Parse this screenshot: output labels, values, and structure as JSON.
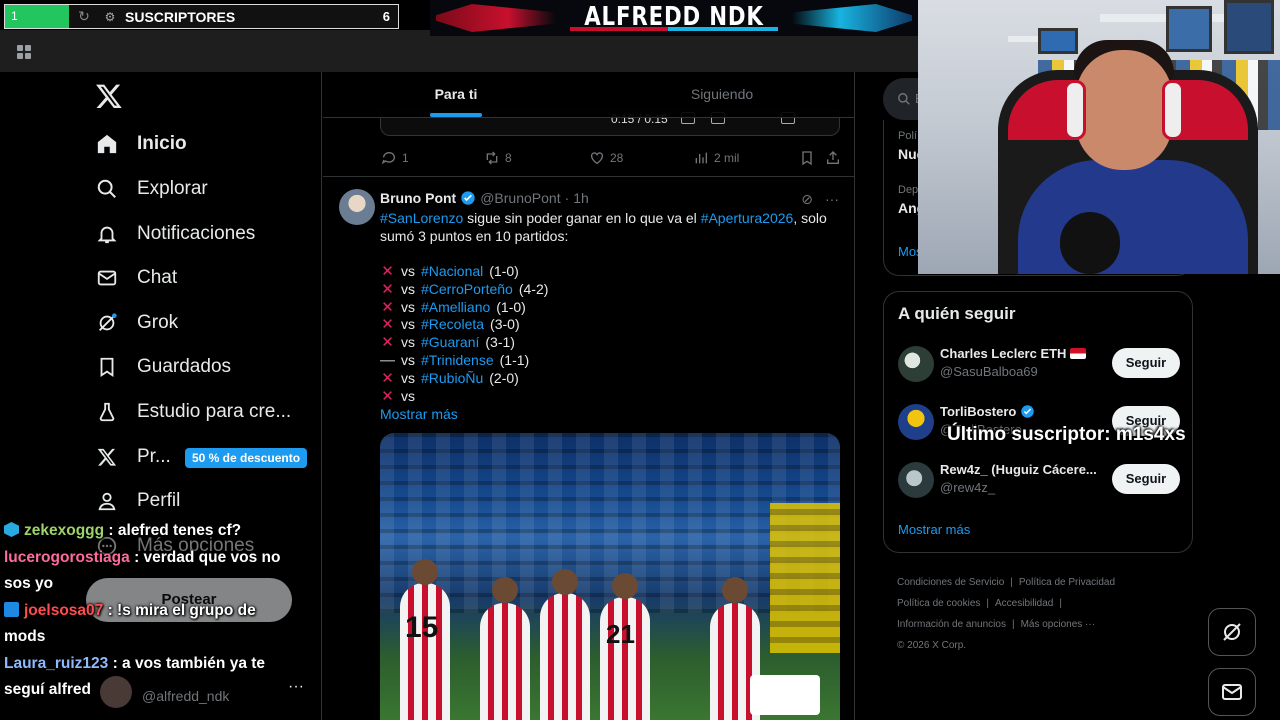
{
  "overlay": {
    "subs_progress_value": "1",
    "subs_label": "SUSCRIPTORES",
    "subs_count": "6",
    "banner_title": "ALFREDD NDK",
    "last_sub_text": "Último suscriptor: m1s4xs"
  },
  "nav": {
    "items": [
      {
        "label": "Inicio",
        "icon": "home-icon"
      },
      {
        "label": "Explorar",
        "icon": "search-icon"
      },
      {
        "label": "Notificaciones",
        "icon": "bell-icon"
      },
      {
        "label": "Chat",
        "icon": "mail-icon"
      },
      {
        "label": "Grok",
        "icon": "grok-icon"
      },
      {
        "label": "Guardados",
        "icon": "bookmark-icon"
      },
      {
        "label": "Estudio para cre...",
        "icon": "flask-icon"
      },
      {
        "label": "Pr...",
        "icon": "x-icon"
      },
      {
        "label": "Perfil",
        "icon": "person-icon"
      },
      {
        "label": "Más opciones",
        "icon": "more-circle-icon"
      }
    ],
    "promo_badge": "50 % de descuento",
    "post_button": "Postear",
    "account_handle": "@alfredd_ndk",
    "account_more": "···"
  },
  "timeline": {
    "tabs": [
      "Para ti",
      "Siguiendo"
    ],
    "video_time": "0:15 / 0:15",
    "prev_actions": {
      "replies": "1",
      "reposts": "8",
      "likes": "28",
      "views": "2 mil"
    },
    "tweet": {
      "name": "Bruno Pont",
      "handle": "@BrunoPont",
      "dot": "·",
      "ago": "1h",
      "text_part1": "#SanLorenzo",
      "text_part2": " sigue sin poder ganar en lo que va el ",
      "text_part3": "#Apertura2026",
      "text_part4": ", solo sumó 3 puntos en 10 partidos:",
      "results": [
        {
          "mark": "✕",
          "pre": "vs",
          "team": "#Nacional",
          "score": "(1-0)"
        },
        {
          "mark": "✕",
          "pre": "vs",
          "team": "#CerroPorteño",
          "score": "(4-2)"
        },
        {
          "mark": "✕",
          "pre": "vs",
          "team": "#Amelliano",
          "score": "(1-0)"
        },
        {
          "mark": "✕",
          "pre": "vs",
          "team": "#Recoleta",
          "score": "(3-0)"
        },
        {
          "mark": "✕",
          "pre": "vs",
          "team": "#Guaraní",
          "score": "(3-1)"
        },
        {
          "mark": "—",
          "pre": "vs",
          "team": "#Trinidense",
          "score": "(1-1)"
        },
        {
          "mark": "✕",
          "pre": "vs",
          "team": "#RubioÑu",
          "score": "(2-0)"
        },
        {
          "mark": "✕",
          "pre": "vs",
          "team": "",
          "score": ""
        }
      ],
      "show_more": "Mostrar más",
      "photo_jersey_numbers": [
        "15",
        "21"
      ]
    }
  },
  "right": {
    "search_placeholder": "B",
    "trend_prev": [
      {
        "small": "Polí",
        "bold": "Nue"
      },
      {
        "small": "Dep",
        "bold": "Ang"
      }
    ],
    "trend_more": "Mos",
    "who_to_follow_title": "A quién seguir",
    "follows": [
      {
        "name": "Charles Leclerc ETH",
        "handle": "@SasuBalboa69",
        "button": "Seguir"
      },
      {
        "name": "TorliBostero",
        "handle": "@TorliBostero",
        "button": "Seguir"
      },
      {
        "name": "Rew4z_ (Huguiz Cácere...",
        "handle": "@rew4z_",
        "button": "Seguir"
      }
    ],
    "show_more": "Mostrar más",
    "footer_links": [
      "Condiciones de Servicio",
      "Política de Privacidad",
      "Política de cookies",
      "Accesibilidad",
      "Información de anuncios",
      "Más opciones ···"
    ],
    "copyright": "© 2026 X Corp."
  },
  "chat": {
    "messages": [
      {
        "user": "zekexoggg",
        "text": ": alefred tenes cf?"
      },
      {
        "user": "lucerogorostiaga",
        "text": ": verdad que vos no sos yo"
      },
      {
        "user": "joelsosa07",
        "text": ": !s mira el grupo de mods"
      },
      {
        "user": "Laura_ruiz123",
        "text": ": a vos también ya te seguí alfred"
      }
    ]
  },
  "colors": {
    "accent": "#1d9bf0",
    "background": "#000000",
    "loss_mark": "#e0245e"
  }
}
